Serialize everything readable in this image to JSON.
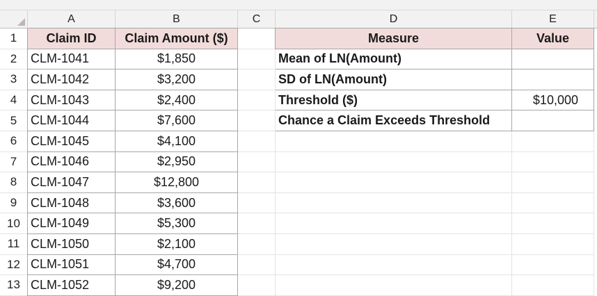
{
  "columns": [
    "A",
    "B",
    "C",
    "D",
    "E"
  ],
  "rows": [
    "1",
    "2",
    "3",
    "4",
    "5",
    "6",
    "7",
    "8",
    "9",
    "10",
    "11",
    "12",
    "13"
  ],
  "claims": {
    "headers": {
      "id": "Claim ID",
      "amount": "Claim Amount ($)"
    },
    "items": [
      {
        "id": "CLM-1041",
        "amount": "$1,850"
      },
      {
        "id": "CLM-1042",
        "amount": "$3,200"
      },
      {
        "id": "CLM-1043",
        "amount": "$2,400"
      },
      {
        "id": "CLM-1044",
        "amount": "$7,600"
      },
      {
        "id": "CLM-1045",
        "amount": "$4,100"
      },
      {
        "id": "CLM-1046",
        "amount": "$2,950"
      },
      {
        "id": "CLM-1047",
        "amount": "$12,800"
      },
      {
        "id": "CLM-1048",
        "amount": "$3,600"
      },
      {
        "id": "CLM-1049",
        "amount": "$5,300"
      },
      {
        "id": "CLM-1050",
        "amount": "$2,100"
      },
      {
        "id": "CLM-1051",
        "amount": "$4,700"
      },
      {
        "id": "CLM-1052",
        "amount": "$9,200"
      }
    ]
  },
  "measures": {
    "headers": {
      "measure": "Measure",
      "value": "Value"
    },
    "items": [
      {
        "measure": "Mean of LN(Amount)",
        "value": ""
      },
      {
        "measure": "SD of LN(Amount)",
        "value": ""
      },
      {
        "measure": "Threshold ($)",
        "value": "$10,000"
      },
      {
        "measure": "Chance a Claim Exceeds Threshold",
        "value": ""
      }
    ]
  },
  "colors": {
    "header_fill": "#f2dcdb",
    "grid_header_bg": "#f2f2f2",
    "table_border": "#a6a6a6"
  }
}
